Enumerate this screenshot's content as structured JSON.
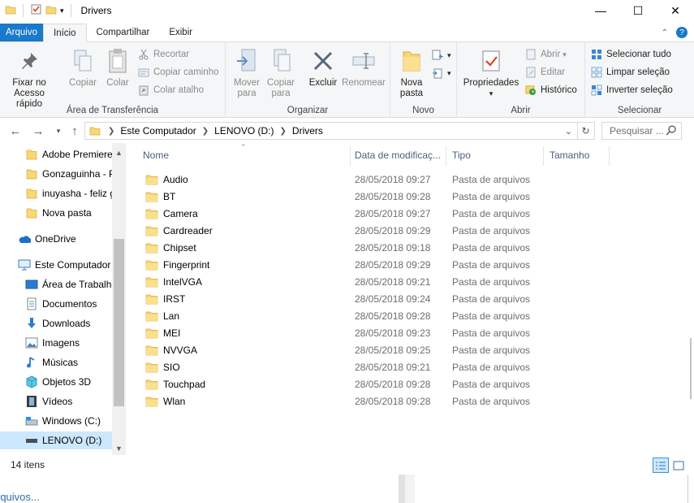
{
  "window": {
    "title": "Drivers",
    "minimize": "—",
    "maximize": "☐",
    "close": "✕"
  },
  "ribbon_tabs": [
    "Arquivo",
    "Início",
    "Compartilhar",
    "Exibir"
  ],
  "ribbon": {
    "clipboard": {
      "pin": [
        "Fixar no",
        "Acesso rápido"
      ],
      "copy": "Copiar",
      "paste": "Colar",
      "cut": "Recortar",
      "copy_path": "Copiar caminho",
      "paste_shortcut": "Colar atalho",
      "label": "Área de Transferência"
    },
    "organize": {
      "move": [
        "Mover",
        "para"
      ],
      "copy_to": [
        "Copiar",
        "para"
      ],
      "delete": "Excluir",
      "rename": "Renomear",
      "label": "Organizar"
    },
    "new": {
      "new_folder": [
        "Nova",
        "pasta"
      ],
      "label": "Novo"
    },
    "open": {
      "properties": "Propriedades",
      "open": "Abrir",
      "edit": "Editar",
      "history": "Histórico",
      "label": "Abrir"
    },
    "select": {
      "select_all": "Selecionar tudo",
      "select_none": "Limpar seleção",
      "invert": "Inverter seleção",
      "label": "Selecionar"
    }
  },
  "address": {
    "crumbs": [
      "Este Computador",
      "LENOVO (D:)",
      "Drivers"
    ],
    "search_placeholder": "Pesquisar ..."
  },
  "nav": {
    "quick": [
      "Adobe Premiere",
      "Gonzaguinha - P",
      "inuyasha - feliz g",
      "Nova pasta"
    ],
    "onedrive": "OneDrive",
    "this_pc": "Este Computador",
    "pc_items": [
      "Área de Trabalho",
      "Documentos",
      "Downloads",
      "Imagens",
      "Músicas",
      "Objetos 3D",
      "Vídeos",
      "Windows (C:)",
      "LENOVO (D:)"
    ]
  },
  "columns": [
    "Nome",
    "Data de modificaç...",
    "Tipo",
    "Tamanho"
  ],
  "files": [
    {
      "name": "Audio",
      "date": "28/05/2018 09:27",
      "type": "Pasta de arquivos"
    },
    {
      "name": "BT",
      "date": "28/05/2018 09:28",
      "type": "Pasta de arquivos"
    },
    {
      "name": "Camera",
      "date": "28/05/2018 09:27",
      "type": "Pasta de arquivos"
    },
    {
      "name": "Cardreader",
      "date": "28/05/2018 09:29",
      "type": "Pasta de arquivos"
    },
    {
      "name": "Chipset",
      "date": "28/05/2018 09:18",
      "type": "Pasta de arquivos"
    },
    {
      "name": "Fingerprint",
      "date": "28/05/2018 09:29",
      "type": "Pasta de arquivos"
    },
    {
      "name": "IntelVGA",
      "date": "28/05/2018 09:21",
      "type": "Pasta de arquivos"
    },
    {
      "name": "IRST",
      "date": "28/05/2018 09:24",
      "type": "Pasta de arquivos"
    },
    {
      "name": "Lan",
      "date": "28/05/2018 09:28",
      "type": "Pasta de arquivos"
    },
    {
      "name": "MEI",
      "date": "28/05/2018 09:23",
      "type": "Pasta de arquivos"
    },
    {
      "name": "NVVGA",
      "date": "28/05/2018 09:25",
      "type": "Pasta de arquivos"
    },
    {
      "name": "SIO",
      "date": "28/05/2018 09:21",
      "type": "Pasta de arquivos"
    },
    {
      "name": "Touchpad",
      "date": "28/05/2018 09:28",
      "type": "Pasta de arquivos"
    },
    {
      "name": "Wlan",
      "date": "28/05/2018 09:28",
      "type": "Pasta de arquivos"
    }
  ],
  "status": {
    "count": "14 itens"
  },
  "background": {
    "partial_text": "rquivos..."
  },
  "colors": {
    "accent": "#1979ca",
    "folder": "#f8d775",
    "selected": "#cce8ff"
  }
}
